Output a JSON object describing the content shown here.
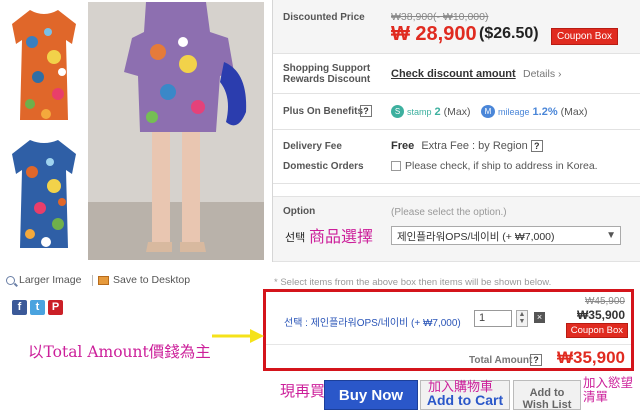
{
  "images": {
    "larger_image": "Larger Image",
    "save_to_desktop": "Save to Desktop",
    "social": [
      "f",
      "t",
      "P"
    ]
  },
  "price": {
    "label": "Discounted Price",
    "original": "₩38,900(- ₩10,000)",
    "current": "₩ 28,900",
    "usd": "($26.50)",
    "coupon": "Coupon Box"
  },
  "support": {
    "label_1": "Shopping Support",
    "label_2": "Rewards Discount",
    "check_link": "Check discount amount",
    "details": "Details ›"
  },
  "benefits": {
    "label": "Plus On Benefits",
    "q": "?",
    "stamp_icon": "S",
    "stamp_text": "stamp",
    "stamp_value": "2",
    "stamp_max": "(Max)",
    "mileage_icon": "M",
    "mileage_text": "mileage",
    "mileage_value": "1.2%",
    "mileage_max": "(Max)"
  },
  "delivery": {
    "label": "Delivery Fee",
    "free": "Free",
    "extra": "Extra Fee : by Region",
    "q": "?"
  },
  "domestic": {
    "label": "Domestic Orders",
    "note": "Please check, if ship to address in Korea."
  },
  "option": {
    "label": "Option",
    "hint": "(Please select the option.)",
    "select_label": "선택",
    "annotation": "商品選擇",
    "selected": "제인플라워OPS/네이비 (+ ₩7,000)",
    "arrow": "▼"
  },
  "select_info": "* Select items from the above box then items will be shown below.",
  "selected_item": {
    "name": "선택 : 제인플라워OPS/네이비 (+ ₩7,000)",
    "qty": "1",
    "remove": "×",
    "orig_price": "₩45,900",
    "price": "₩35,900",
    "coupon": "Coupon Box",
    "total_label": "Total Amount",
    "q": "?",
    "total_value": "₩35,900"
  },
  "annotations": {
    "total_note": "以Total Amount價錢為主",
    "buy_note": "現再買",
    "cart_note": "加入購物車",
    "wish_note_1": "加入慾望",
    "wish_note_2": "清單"
  },
  "buttons": {
    "buy_now": "Buy Now",
    "add_to_cart": "Add to Cart",
    "wish_1": "Add to",
    "wish_2": "Wish List"
  },
  "colors": {
    "price_red": "#e02b20",
    "annotation_pink": "#cc1f9a",
    "buy_blue": "#2a57c9",
    "highlight_red": "#d4141b",
    "arrow_yellow": "#f5e21a"
  }
}
